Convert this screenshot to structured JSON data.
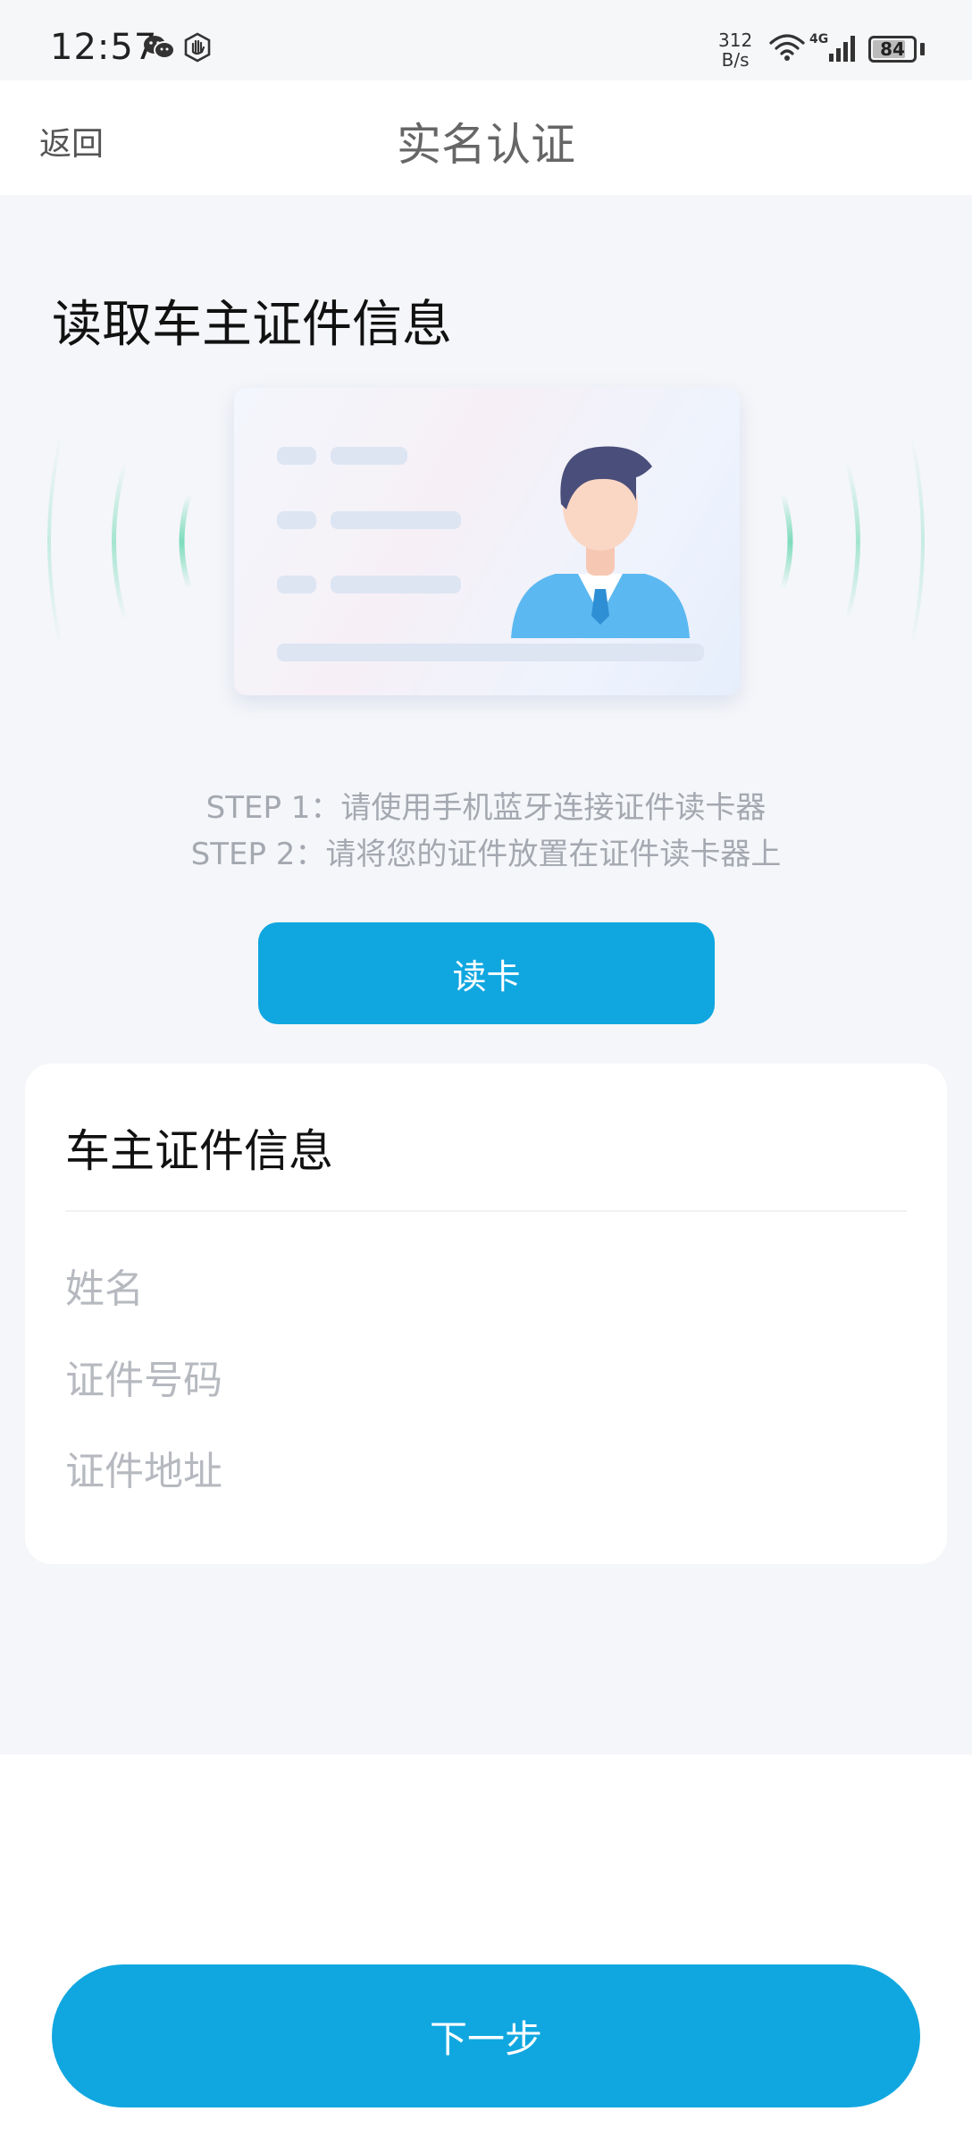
{
  "status_bar": {
    "time": "12:57",
    "net_speed_value": "312",
    "net_speed_unit": "B/s",
    "network_type": "4G",
    "battery_level": "84",
    "icons": [
      "wechat-icon",
      "hand-icon",
      "wifi-icon",
      "signal-icon",
      "battery-icon"
    ]
  },
  "nav": {
    "back_label": "返回",
    "title": "实名认证"
  },
  "main": {
    "section_title": "读取车主证件信息",
    "steps": [
      "STEP 1：请使用手机蓝牙连接证件读卡器",
      "STEP 2：请将您的证件放置在证件读卡器上"
    ],
    "read_card_label": "读卡"
  },
  "info_card": {
    "title": "车主证件信息",
    "fields": [
      "姓名",
      "证件号码",
      "证件地址"
    ]
  },
  "footer": {
    "next_label": "下一步"
  },
  "colors": {
    "accent": "#10a7e0",
    "background": "#f5f6f9",
    "signal_wave": "#6fd9b4",
    "avatar_shirt": "#5cb8f0",
    "avatar_hair": "#4a4e7a"
  }
}
